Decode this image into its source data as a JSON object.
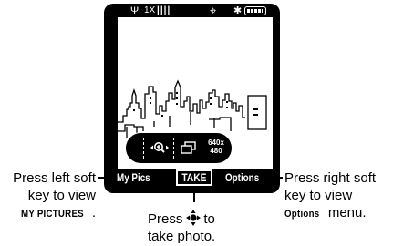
{
  "status_bar": {
    "network_label": "1X",
    "icons": [
      "signal-strength-icon",
      "network-1x-icon",
      "signal-bars-icon",
      "gps-icon",
      "bluetooth-icon",
      "battery-icon"
    ]
  },
  "viewfinder": {
    "scene": "city skyline preview"
  },
  "camera_controls": {
    "zoom_icon": "zoom-in-icon",
    "frame_icon": "frame-mode-icon",
    "resolution_top": "640x",
    "resolution_bottom": "480",
    "capture_icon": "camera-icon"
  },
  "softkeys": {
    "left": "My Pics",
    "center": "TAKE",
    "right": "Options"
  },
  "callouts": {
    "left": {
      "line1": "Press left soft",
      "line2": "key to view",
      "key": "MY PICTURES",
      "suffix": "."
    },
    "right": {
      "line1": "Press right soft",
      "line2": "key to view",
      "key": "Options",
      "suffix": " menu."
    },
    "center": {
      "prefix": "Press",
      "suffix": "to",
      "line2": "take photo.",
      "icon": "navigation-center-key-icon"
    }
  },
  "colors": {
    "screen": "#000000",
    "viewfinder": "#ffffff",
    "text": "#000000"
  }
}
